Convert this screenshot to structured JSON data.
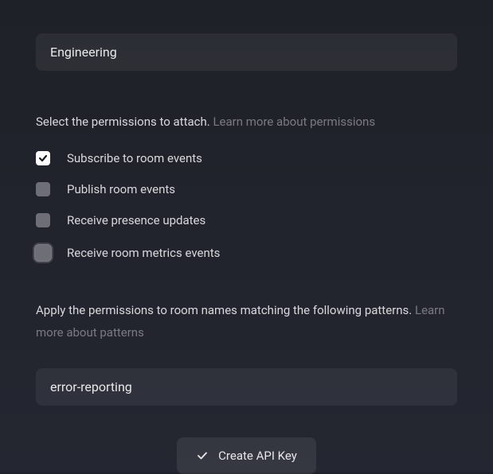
{
  "name_input": {
    "value": "Engineering"
  },
  "permissions": {
    "label": "Select the permissions to attach.",
    "learn_more": "Learn more about permissions",
    "items": [
      {
        "label": "Subscribe to room events",
        "checked": true,
        "focused": false
      },
      {
        "label": "Publish room events",
        "checked": false,
        "focused": false
      },
      {
        "label": "Receive presence updates",
        "checked": false,
        "focused": false
      },
      {
        "label": "Receive room metrics events",
        "checked": false,
        "focused": true
      }
    ]
  },
  "patterns": {
    "label": "Apply the permissions to room names matching the following patterns.",
    "learn_more": "Learn more about patterns",
    "input_value": "error-reporting"
  },
  "submit": {
    "label": "Create API Key"
  }
}
